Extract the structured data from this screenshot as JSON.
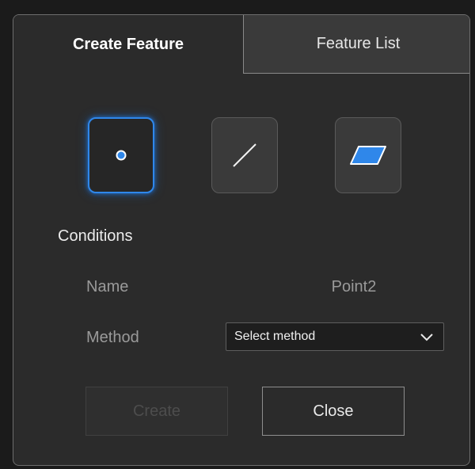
{
  "tabs": {
    "create_feature": "Create Feature",
    "feature_list": "Feature List",
    "active": "create_feature"
  },
  "feature_types": [
    {
      "icon": "point-icon",
      "selected": true
    },
    {
      "icon": "line-icon",
      "selected": false
    },
    {
      "icon": "plane-icon",
      "selected": false
    }
  ],
  "conditions": {
    "title": "Conditions",
    "name_label": "Name",
    "name_value": "Point2",
    "method_label": "Method",
    "method_value": "Select method"
  },
  "buttons": {
    "create": "Create",
    "create_enabled": false,
    "close": "Close"
  },
  "colors": {
    "accent": "#2f87ea",
    "panel": "#2b2b2b",
    "text_muted": "#9a9a9a"
  }
}
